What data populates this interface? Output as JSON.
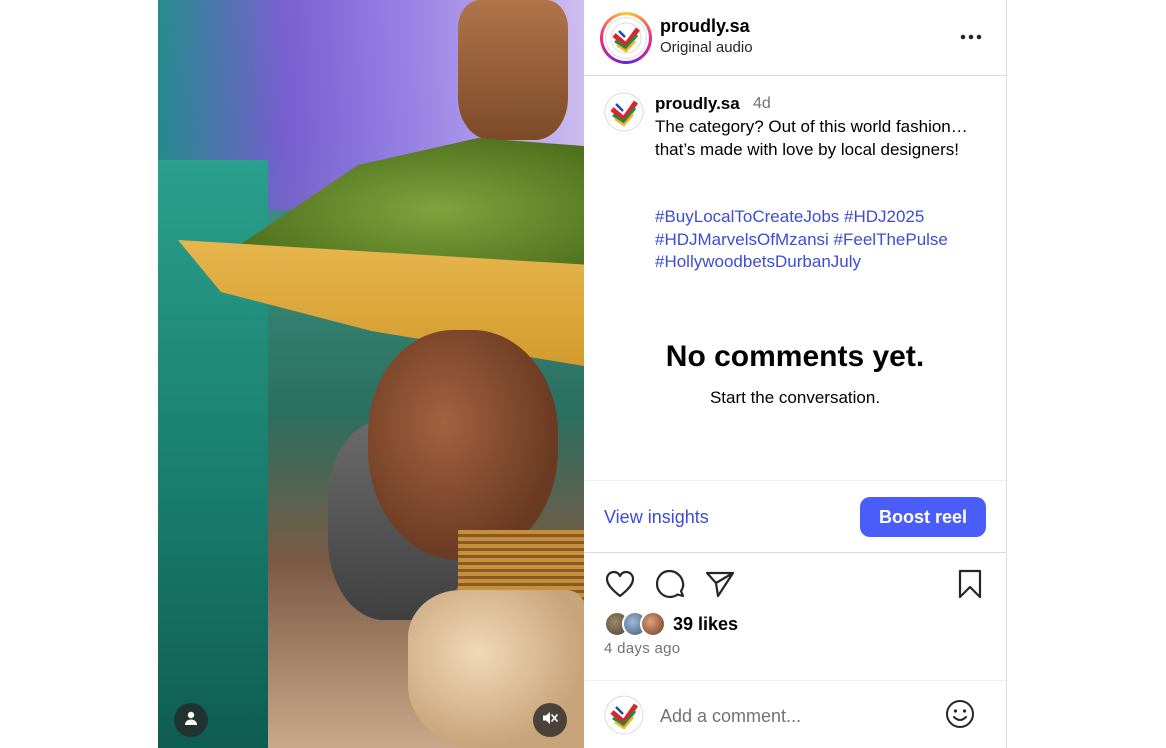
{
  "post": {
    "username": "proudly.sa",
    "audio": "Original audio",
    "caption": {
      "username": "proudly.sa",
      "time": "4d",
      "text": "The category? Out of this world fashion…that’s made with love by local designers!",
      "hashtags": [
        "#BuyLocalToCreateJobs",
        "#HDJ2025",
        "#HDJMarvelsOfMzansi",
        "#FeelThePulse",
        "#HollywoodbetsDurbanJuly"
      ]
    },
    "empty_state": {
      "title": "No comments yet.",
      "subtitle": "Start the conversation."
    },
    "insights": {
      "view_label": "View insights",
      "boost_label": "Boost reel"
    },
    "likes": "39 likes",
    "posted_ago": "4 days ago",
    "comment_input": {
      "placeholder": "Add a comment..."
    },
    "icons": {
      "more": "more-options-icon",
      "like": "heart-icon",
      "comment": "comment-icon",
      "share": "send-icon",
      "save": "bookmark-icon",
      "emoji": "emoji-icon",
      "mute": "muted-speaker-icon",
      "user": "user-icon"
    }
  },
  "colors": {
    "link": "#3d4cd6",
    "boost_button": "#4a5df9",
    "muted_text": "#737373",
    "border": "#dbdbdb"
  }
}
